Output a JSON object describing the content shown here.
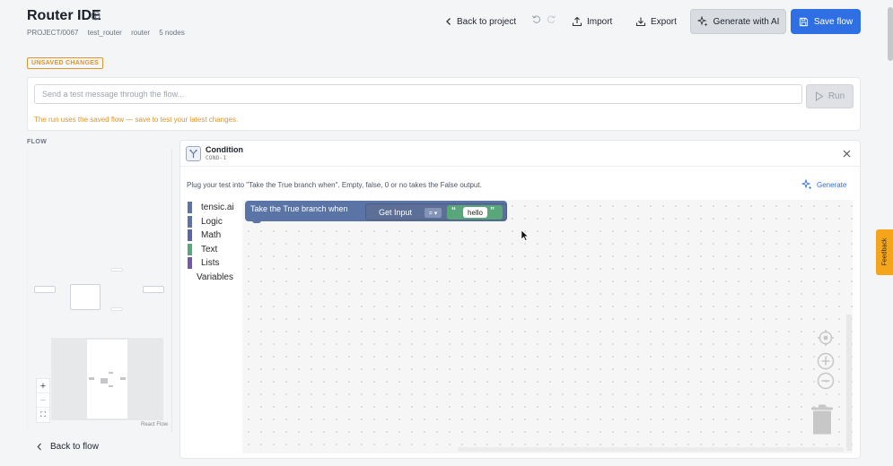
{
  "header": {
    "title": "Router IDE",
    "meta": [
      "PROJECT/0067",
      "test_router",
      "router",
      "5 nodes"
    ],
    "back_label": "Back to project",
    "import_label": "Import",
    "export_label": "Export",
    "generate_label": "Generate with AI",
    "save_label": "Save flow"
  },
  "status": {
    "unsaved_badge": "UNSAVED CHANGES"
  },
  "test": {
    "placeholder": "Send a test message through the flow...",
    "run_label": "Run",
    "note": "The run uses the saved flow — save to test your latest changes."
  },
  "flow": {
    "section_label": "FLOW",
    "attribution": "React Flow",
    "back_label": "Back to flow",
    "zoom_controls": [
      "+",
      "−",
      "⛶"
    ]
  },
  "condition": {
    "title": "Condition",
    "id": "COND-1",
    "description": "Plug your test into \"Take the True branch when\". Empty, false, 0 or no takes the False output.",
    "generate_label": "Generate",
    "toolbox": [
      {
        "label": "tensic.ai",
        "color": "#5b74a6"
      },
      {
        "label": "Logic",
        "color": "#5b74a6"
      },
      {
        "label": "Math",
        "color": "#5b67a5"
      },
      {
        "label": "Text",
        "color": "#5aa67b"
      },
      {
        "label": "Lists",
        "color": "#745ba6"
      },
      {
        "label": "Variables",
        "color": ""
      }
    ],
    "block": {
      "label": "Take the True branch when",
      "get_input_label": "Get Input",
      "operator": "= ▾",
      "open_quote": "“",
      "value": "hello",
      "close_quote": "”"
    }
  },
  "feedback_label": "Feedback",
  "colors": {
    "primary": "#2f6fe4",
    "warning": "#e0952d",
    "logic_block": "#5b74a6",
    "text_block": "#5aa67b",
    "feedback_tab": "#f4a51c"
  }
}
